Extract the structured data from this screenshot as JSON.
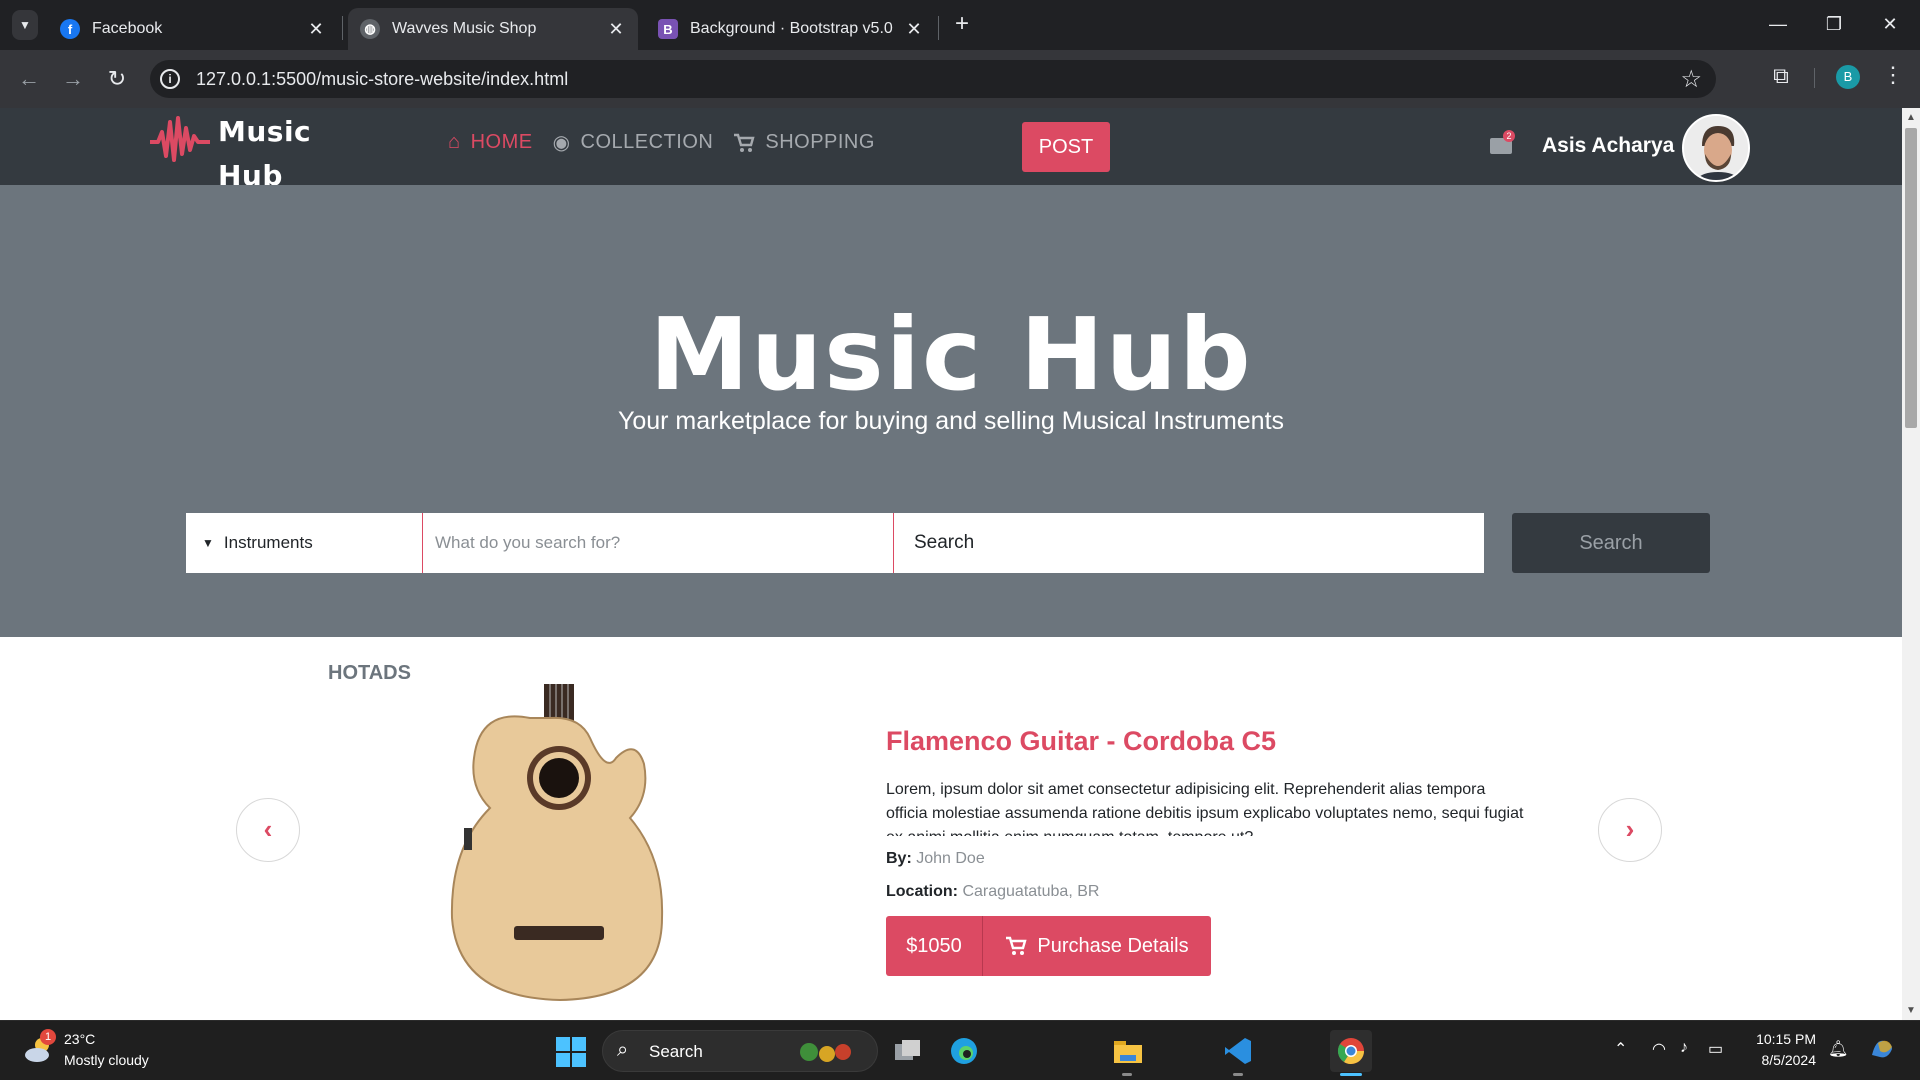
{
  "browser": {
    "tabs": [
      {
        "title": "Facebook",
        "favicon": "facebook-icon",
        "active": false
      },
      {
        "title": "Wavves Music Shop",
        "favicon": "globe-icon",
        "active": true
      },
      {
        "title": "Background · Bootstrap v5.0",
        "favicon": "bootstrap-icon",
        "active": false
      }
    ],
    "url": "127.0.0.1:5500/music-store-website/index.html",
    "profile_initial": "B"
  },
  "site": {
    "logo_line1": "Music",
    "logo_line2": "Hub",
    "nav": [
      {
        "label": "HOME",
        "icon": "home-icon",
        "active": true
      },
      {
        "label": "COLLECTION",
        "icon": "disc-icon",
        "active": false
      },
      {
        "label": "SHOPPING",
        "icon": "cart-icon",
        "active": false
      }
    ],
    "post_label": "POST",
    "mail_count": "2",
    "username": "Asis Acharya",
    "accent_color": "#dc4a63"
  },
  "hero": {
    "title": "Music Hub",
    "subtitle": "Your marketplace for buying and selling Musical Instruments",
    "category": "Instruments",
    "search_placeholder": "What do you search for?",
    "location_text": "Search",
    "search_button": "Search"
  },
  "hotads": {
    "label": "HOTADS",
    "item": {
      "title": "Flamenco Guitar - Cordoba C5",
      "description": "Lorem, ipsum dolor sit amet consectetur adipisicing elit. Reprehenderit alias tempora officia molestiae assumenda ratione debitis ipsum explicabo voluptates nemo, sequi fugiat ex animi mollitia enim numquam totam, tempore ut?",
      "by_label": "By:",
      "by_value": "John Doe",
      "location_label": "Location:",
      "location_value": "Caraguatatuba, BR",
      "price": "$1050",
      "purchase_label": "Purchase Details"
    }
  },
  "taskbar": {
    "weather_badge": "1",
    "temperature": "23°C",
    "weather": "Mostly cloudy",
    "search_label": "Search",
    "time": "10:15 PM",
    "date": "8/5/2024"
  }
}
